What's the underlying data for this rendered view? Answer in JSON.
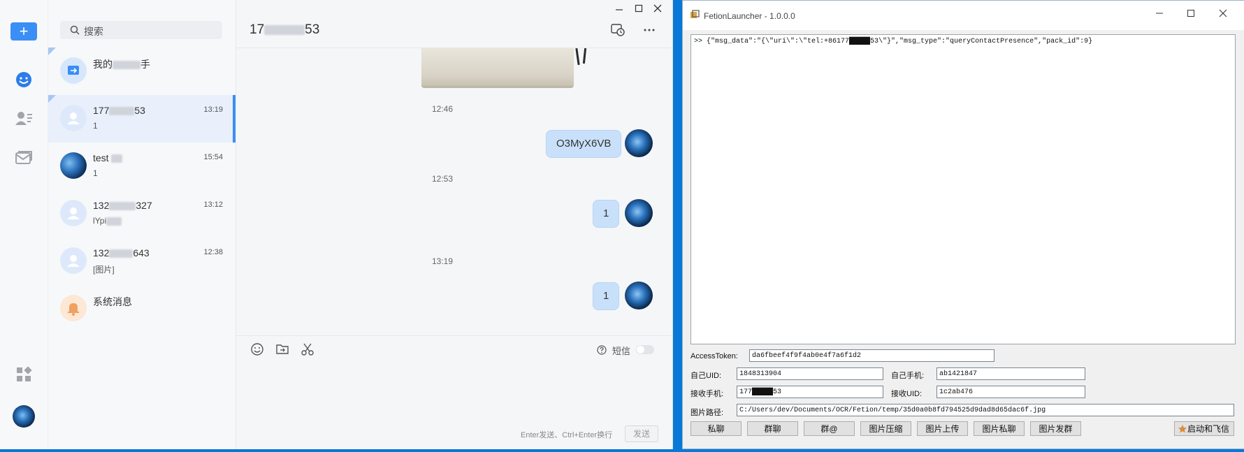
{
  "chat_app": {
    "rail": {
      "new_button": "+"
    },
    "search": {
      "placeholder": "搜索"
    },
    "conversations": [
      {
        "name": "我的",
        "name_tail": "手",
        "snippet": "",
        "time": ""
      },
      {
        "name": "177",
        "name_tail": "53",
        "snippet": "1",
        "time": "13:19"
      },
      {
        "name": "test",
        "name_tail": "",
        "snippet": "1",
        "time": "15:54"
      },
      {
        "name": "132",
        "name_tail": "327",
        "snippet": "lYpi",
        "time": "13:12"
      },
      {
        "name": "132",
        "name_tail": "643",
        "snippet": "[图片]",
        "time": "12:38"
      },
      {
        "name": "系统消息",
        "name_tail": "",
        "snippet": "",
        "time": ""
      }
    ],
    "header": {
      "title_head": "17",
      "title_tail": "53"
    },
    "messages": [
      {
        "time": "12:46",
        "text": "O3MyX6VB"
      },
      {
        "time": "12:53",
        "text": "1"
      },
      {
        "time": "13:19",
        "text": "1"
      }
    ],
    "composer": {
      "sms_label": "短信",
      "hint": "Enter发送、Ctrl+Enter换行",
      "send_label": "发送"
    }
  },
  "launcher": {
    "title": "FetionLauncher - 1.0.0.0",
    "log": ">> {\"msg_data\":\"{\\\"uri\\\":\\\"tel:+86177█████53\\\"}\",\"msg_type\":\"queryContactPresence\",\"pack_id\":9}",
    "fields": {
      "access_token_label": "AccessToken:",
      "access_token_value": "da6fbeef4f9f4ab0e4f7a6f1d2",
      "self_uid_label": "自己UID:",
      "self_uid_value": "1848313904",
      "self_phone_label": "自己手机:",
      "self_phone_value": "ab1421847",
      "recv_phone_label": "接收手机:",
      "recv_phone_value": "177█████53",
      "recv_uid_label": "接收UID:",
      "recv_uid_value": "1c2ab476",
      "image_path_label": "图片路径:",
      "image_path_value": "C:/Users/dev/Documents/OCR/Fetion/temp/35d0a0b8fd794525d9dad8d65dac6f.jpg"
    },
    "buttons": [
      "私聊",
      "群聊",
      "群@",
      "图片压缩",
      "图片上传",
      "图片私聊",
      "图片发群",
      "启动和飞信"
    ]
  }
}
